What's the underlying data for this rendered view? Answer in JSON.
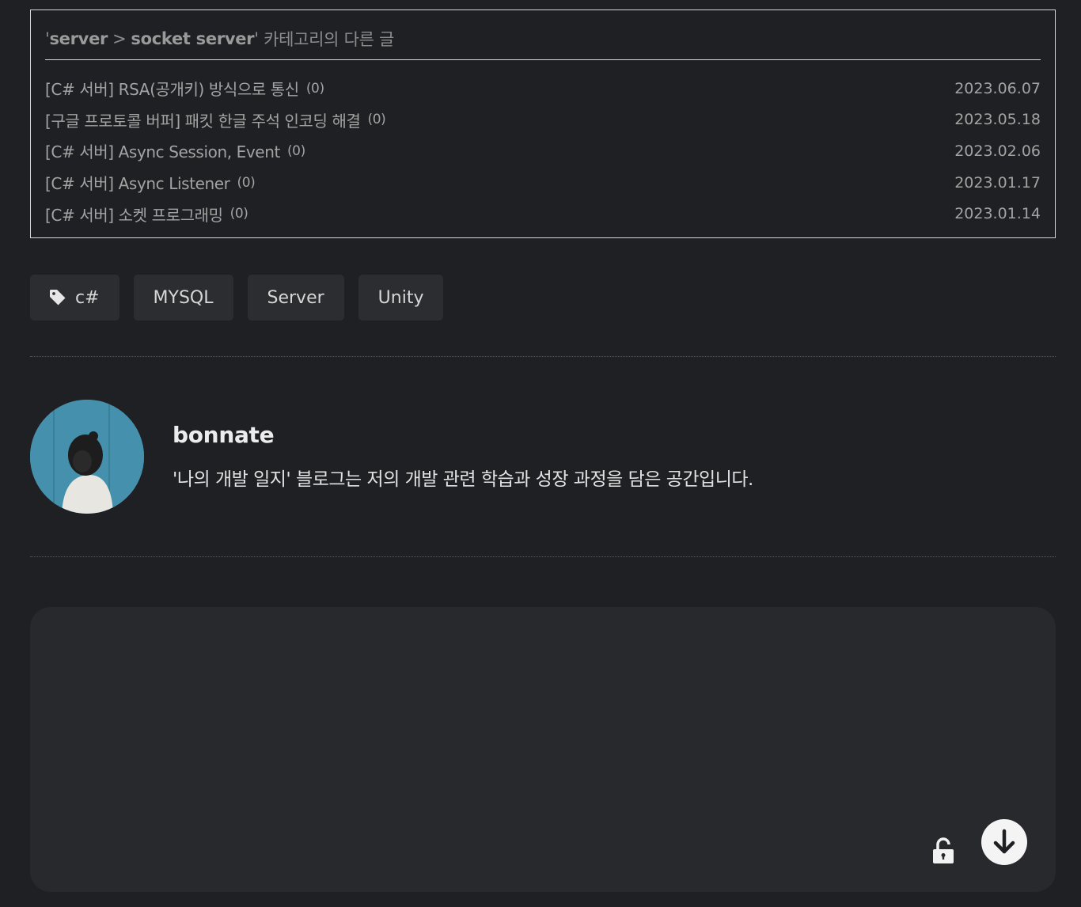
{
  "related": {
    "category_part1": "server",
    "category_sep": ">",
    "category_part2": "socket server",
    "quote_open": "'",
    "quote_close": "'",
    "heading_suffix": " 카테고리의 다른 글",
    "items": [
      {
        "title": "[C# 서버] RSA(공개키) 방식으로 통신",
        "count": "(0)",
        "date": "2023.06.07"
      },
      {
        "title": "[구글 프로토콜 버퍼] 패킷 한글 주석 인코딩 해결",
        "count": "(0)",
        "date": "2023.05.18"
      },
      {
        "title": "[C# 서버] Async Session, Event",
        "count": "(0)",
        "date": "2023.02.06"
      },
      {
        "title": "[C# 서버] Async Listener",
        "count": "(0)",
        "date": "2023.01.17"
      },
      {
        "title": "[C# 서버] 소켓 프로그래밍",
        "count": "(0)",
        "date": "2023.01.14"
      }
    ]
  },
  "tags": [
    {
      "label": "c#",
      "icon": "tag-icon"
    },
    {
      "label": "MYSQL"
    },
    {
      "label": "Server"
    },
    {
      "label": "Unity"
    }
  ],
  "author": {
    "name": "bonnate",
    "description": "'나의 개발 일지' 블로그는 저의 개발 관련 학습과 성장 과정을 담은 공간입니다."
  },
  "comment": {
    "lock_icon": "unlock-icon",
    "submit_icon": "arrow-down-circle-icon"
  },
  "colors": {
    "background": "#1f2023",
    "panel": "#28292d",
    "tag_bg": "#2c2d31",
    "border": "#d8d8d8",
    "avatar_bg": "#4a97b2"
  }
}
